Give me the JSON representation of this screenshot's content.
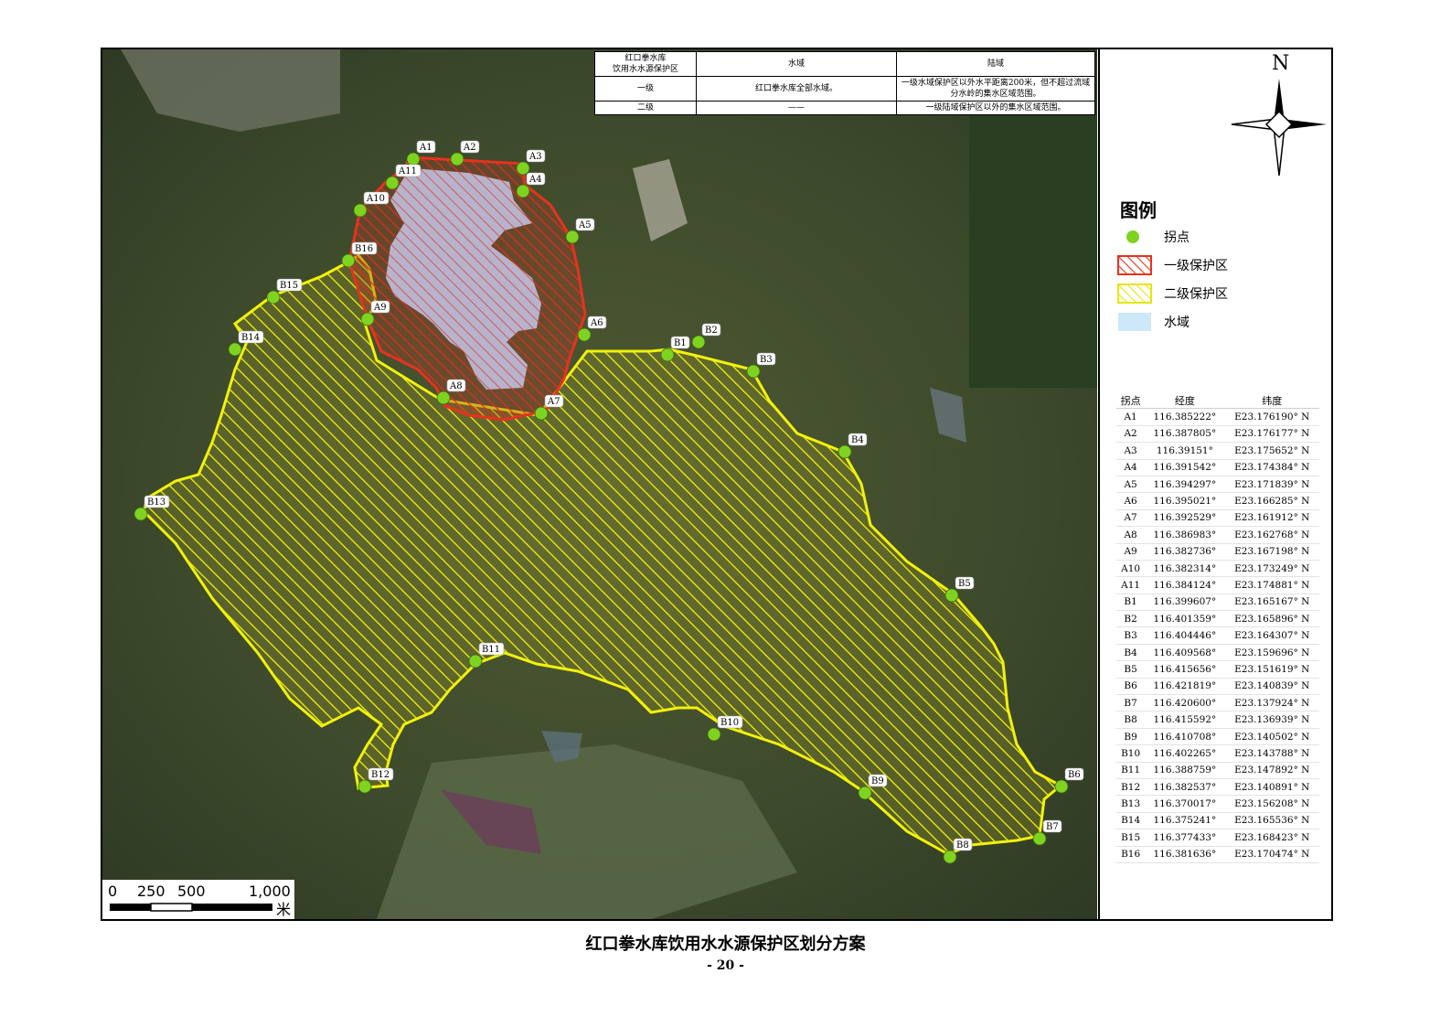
{
  "attr_table": {
    "header": [
      "红口拳水库\n饮用水水源保护区",
      "水域",
      "陆域"
    ],
    "rows": [
      [
        "一级",
        "红口拳水库全部水域。",
        "一级水域保护区以外水平距离200米，但不超过流域分水岭的集水区域范围。"
      ],
      [
        "二级",
        "——",
        "一级陆域保护区以外的集水区域范围。"
      ]
    ]
  },
  "north_label": "N",
  "legend": {
    "title": "图例",
    "items": [
      {
        "label": "拐点",
        "kind": "point",
        "color": "#7ed321"
      },
      {
        "label": "一级保护区",
        "kind": "hatch",
        "color": "#e8321e"
      },
      {
        "label": "二级保护区",
        "kind": "hatch",
        "color": "#f2f20a"
      },
      {
        "label": "水域",
        "kind": "fill",
        "color": "#cde8f8"
      }
    ]
  },
  "coord_table": {
    "headers": [
      "拐点",
      "经度",
      "纬度"
    ],
    "rows": [
      [
        "A1",
        "116.385222°",
        "E23.176190° N"
      ],
      [
        "A2",
        "116.387805°",
        "E23.176177° N"
      ],
      [
        "A3",
        "116.39151°",
        "E23.175652° N"
      ],
      [
        "A4",
        "116.391542°",
        "E23.174384° N"
      ],
      [
        "A5",
        "116.394297°",
        "E23.171839° N"
      ],
      [
        "A6",
        "116.395021°",
        "E23.166285° N"
      ],
      [
        "A7",
        "116.392529°",
        "E23.161912° N"
      ],
      [
        "A8",
        "116.386983°",
        "E23.162768° N"
      ],
      [
        "A9",
        "116.382736°",
        "E23.167198° N"
      ],
      [
        "A10",
        "116.382314°",
        "E23.173249° N"
      ],
      [
        "A11",
        "116.384124°",
        "E23.174881° N"
      ],
      [
        "B1",
        "116.399607°",
        "E23.165167° N"
      ],
      [
        "B2",
        "116.401359°",
        "E23.165896° N"
      ],
      [
        "B3",
        "116.404446°",
        "E23.164307° N"
      ],
      [
        "B4",
        "116.409568°",
        "E23.159696° N"
      ],
      [
        "B5",
        "116.415656°",
        "E23.151619° N"
      ],
      [
        "B6",
        "116.421819°",
        "E23.140839° N"
      ],
      [
        "B7",
        "116.420600°",
        "E23.137924° N"
      ],
      [
        "B8",
        "116.415592°",
        "E23.136939° N"
      ],
      [
        "B9",
        "116.410708°",
        "E23.140502° N"
      ],
      [
        "B10",
        "116.402265°",
        "E23.143788° N"
      ],
      [
        "B11",
        "116.388759°",
        "E23.147892° N"
      ],
      [
        "B12",
        "116.382537°",
        "E23.140891° N"
      ],
      [
        "B13",
        "116.370017°",
        "E23.156208° N"
      ],
      [
        "B14",
        "116.375241°",
        "E23.165536° N"
      ],
      [
        "B15",
        "116.377433°",
        "E23.168423° N"
      ],
      [
        "B16",
        "116.381636°",
        "E23.170474° N"
      ]
    ]
  },
  "scale_bar": {
    "ticks": [
      "0",
      "250",
      "500",
      "1,000"
    ],
    "unit": "米"
  },
  "colors": {
    "primary_zone": "#e8321e",
    "secondary_zone": "#f2f20a",
    "point": "#7ed321",
    "water": "#b9b4cc"
  },
  "caption": "红口拳水库饮用水水源保护区划分方案",
  "page_number": "- 20 -"
}
